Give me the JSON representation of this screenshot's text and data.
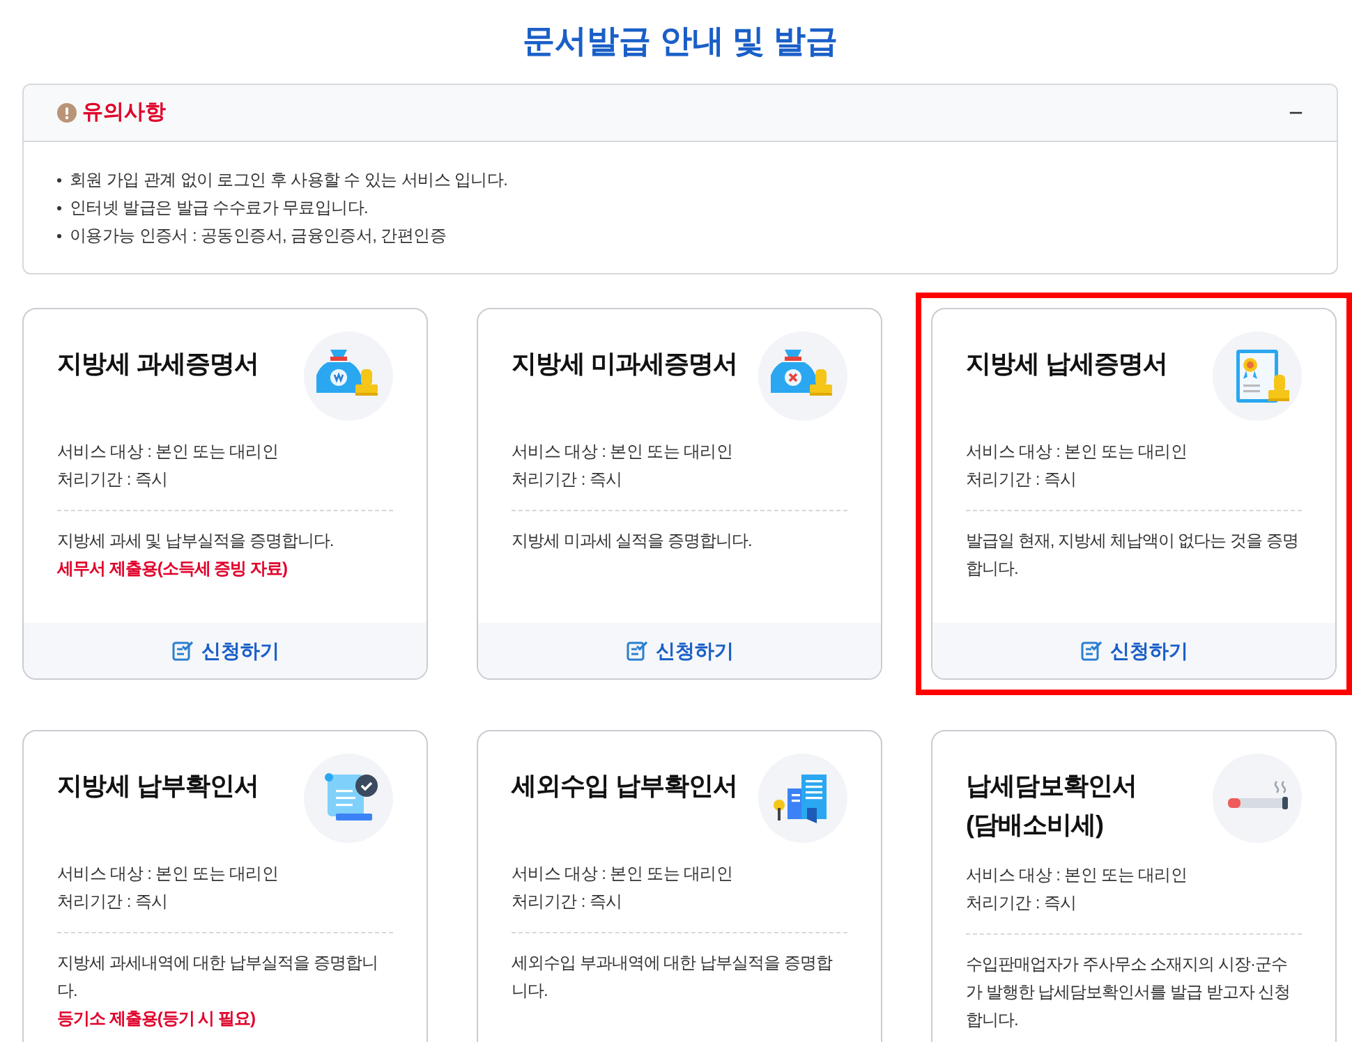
{
  "page_title": "문서발급 안내 및 발급",
  "notice": {
    "title": "유의사항",
    "expanded": true,
    "toggle": "−",
    "items": [
      "회원 가입 관계 없이 로그인 후 사용할 수 있는 서비스 입니다.",
      "인터넷 발급은 발급 수수료가 무료입니다.",
      "이용가능 인증서 : 공동인증서, 금융인증서, 간편인증"
    ]
  },
  "cards": [
    {
      "title": "지방세 과세증명서",
      "highlighted": false,
      "info": [
        "서비스 대상 : 본인 또는 대리인",
        "처리기간 : 즉시"
      ],
      "description": "지방세 과세 및 납부실적을 증명합니다.",
      "note": "세무서 제출용(소득세 증빙 자료)",
      "button": "신청하기"
    },
    {
      "title": "지방세 미과세증명서",
      "highlighted": false,
      "info": [
        "서비스 대상 : 본인 또는 대리인",
        "처리기간 : 즉시"
      ],
      "description": "지방세 미과세 실적을 증명합니다.",
      "button": "신청하기"
    },
    {
      "title": "지방세 납세증명서",
      "highlighted": true,
      "info": [
        "서비스 대상 : 본인 또는 대리인",
        "처리기간 : 즉시"
      ],
      "description": "발급일 현재, 지방세 체납액이 없다는 것을 증명합니다.",
      "button": "신청하기"
    },
    {
      "title": "지방세 납부확인서",
      "highlighted": false,
      "info": [
        "서비스 대상 : 본인 또는 대리인",
        "처리기간 : 즉시"
      ],
      "description": "지방세 과세내역에 대한 납부실적을 증명합니다.",
      "note": "등기소 제출용(등기 시 필요)"
    },
    {
      "title": "세외수입 납부확인서",
      "highlighted": false,
      "info": [
        "서비스 대상 : 본인 또는 대리인",
        "처리기간 : 즉시"
      ],
      "description": "세외수입 부과내역에 대한 납부실적을 증명합니다."
    },
    {
      "title": "납세담보확인서\n(담배소비세)",
      "highlighted": false,
      "info": [
        "서비스 대상 : 본인 또는 대리인",
        "처리기간 : 즉시"
      ],
      "description": "수입판매업자가 주사무소 소재지의 시장·군수가 발행한 납세담보확인서를 발급 받고자 신청합니다."
    }
  ]
}
